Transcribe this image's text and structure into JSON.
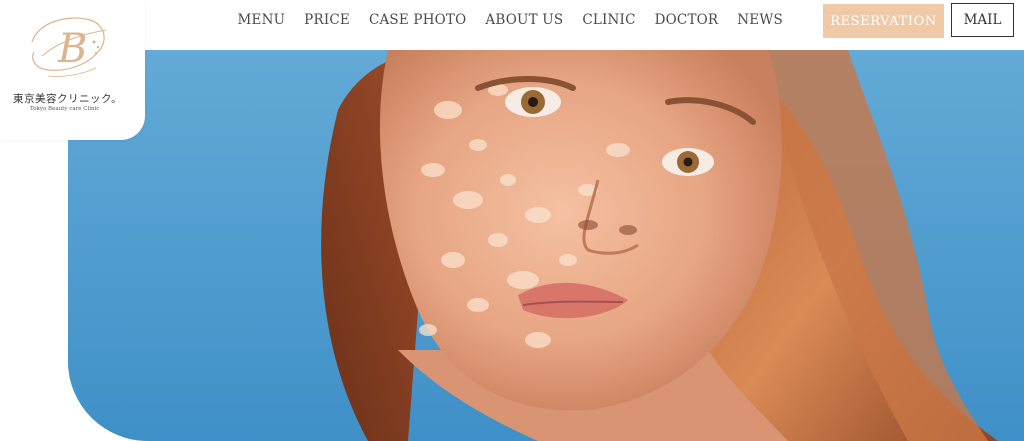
{
  "header": {
    "nav": [
      {
        "label": "MENU"
      },
      {
        "label": "PRICE"
      },
      {
        "label": "CASE PHOTO"
      },
      {
        "label": "ABOUT US"
      },
      {
        "label": "CLINIC"
      },
      {
        "label": "DOCTOR"
      },
      {
        "label": "NEWS"
      }
    ],
    "reservation_label": "RESERVATION",
    "mail_label": "MAIL"
  },
  "logo": {
    "name_jp": "東京美容クリニック。",
    "name_en": "Tokyo Beauty care Clinic",
    "mark_letter": "B"
  },
  "colors": {
    "accent": "#f0c9a6",
    "logo_gold": "#dcb48e",
    "nav_text": "#4a4a4a",
    "sky": "#4f9fd0"
  },
  "hero": {
    "image": "portrait-photo"
  }
}
